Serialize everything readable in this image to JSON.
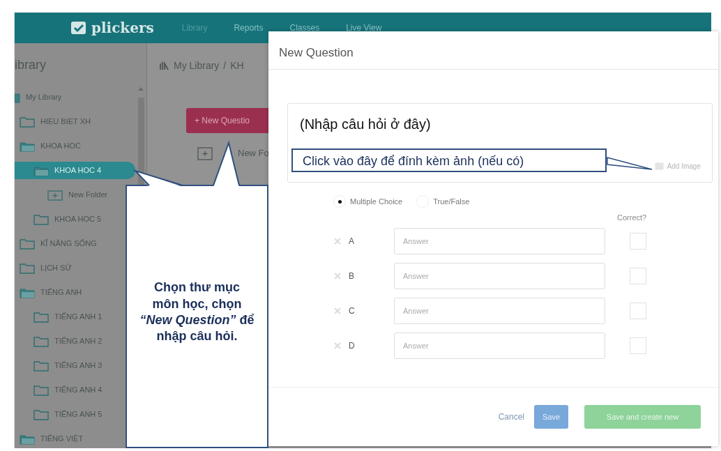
{
  "nav": {
    "logo": "plickers",
    "links": [
      {
        "label": "Library",
        "selected": true
      },
      {
        "label": "Reports",
        "selected": false
      },
      {
        "label": "Classes",
        "selected": false
      },
      {
        "label": "Live View",
        "selected": false
      }
    ]
  },
  "sidebar": {
    "title": "ibrary",
    "tree": [
      {
        "label": "My Library",
        "kind": "root",
        "expanded": true,
        "selected": false,
        "children": [
          {
            "label": "HIEU BIET XH",
            "kind": "folder",
            "expanded": false,
            "selected": false
          },
          {
            "label": "KHOA HOC",
            "kind": "folder",
            "expanded": true,
            "selected": false,
            "children": [
              {
                "label": "KHOA HOC 4",
                "kind": "folder",
                "expanded": true,
                "selected": true,
                "children": [
                  {
                    "label": "New Folder",
                    "kind": "new-folder",
                    "selected": false
                  }
                ]
              },
              {
                "label": "KHOA HOC 5",
                "kind": "folder",
                "expanded": false,
                "selected": false
              }
            ]
          },
          {
            "label": "KĨ NĂNG SỐNG",
            "kind": "folder",
            "expanded": false,
            "selected": false
          },
          {
            "label": "LỊCH SỬ",
            "kind": "folder",
            "expanded": false,
            "selected": false
          },
          {
            "label": "TIẾNG ANH",
            "kind": "folder",
            "expanded": true,
            "selected": false,
            "children": [
              {
                "label": "TIẾNG ANH 1",
                "kind": "folder",
                "expanded": false,
                "selected": false
              },
              {
                "label": "TIẾNG ANH 2",
                "kind": "folder",
                "expanded": false,
                "selected": false
              },
              {
                "label": "TIẾNG ANH 3",
                "kind": "folder",
                "expanded": false,
                "selected": false
              },
              {
                "label": "TIẾNG ANH 4",
                "kind": "folder",
                "expanded": false,
                "selected": false
              },
              {
                "label": "TIẾNG ANH 5",
                "kind": "folder",
                "expanded": false,
                "selected": false
              }
            ]
          },
          {
            "label": "TIẾNG VIỆT",
            "kind": "folder",
            "expanded": true,
            "selected": false
          }
        ]
      }
    ]
  },
  "main": {
    "breadcrumb": [
      "My Library",
      "KH"
    ],
    "breadcrumb_separator": "/",
    "new_question_button": "+ New Questio",
    "new_folder": "New Fo"
  },
  "modal": {
    "title": "New Question",
    "question": "(Nhập câu hỏi ở đây)",
    "add_image": "Add Image",
    "types": [
      {
        "label": "Multiple Choice",
        "selected": true
      },
      {
        "label": "True/False",
        "selected": false
      }
    ],
    "correct_heading": "Correct?",
    "answers": [
      {
        "letter": "A",
        "placeholder": "Answer",
        "correct": false
      },
      {
        "letter": "B",
        "placeholder": "Answer",
        "correct": false
      },
      {
        "letter": "C",
        "placeholder": "Answer",
        "correct": false
      },
      {
        "letter": "D",
        "placeholder": "Answer",
        "correct": false
      }
    ],
    "cancel": "Cancel",
    "save": "Save",
    "save_new": "Save and create new"
  },
  "annotations": [
    {
      "kind": "callout",
      "text": "Chọn thư mục môn học, chọn *“New Question”* để nhập câu hỏi."
    },
    {
      "kind": "note",
      "text": "Click vào đây để đính kèm ảnh (nếu có)"
    }
  ]
}
